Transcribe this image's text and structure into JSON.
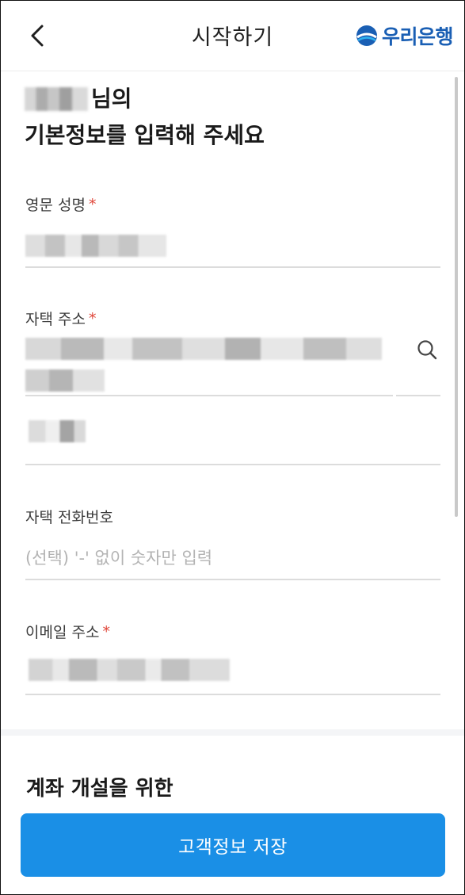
{
  "header": {
    "title": "시작하기",
    "logo_text": "우리은행"
  },
  "greeting": {
    "suffix": "님의",
    "line2": "기본정보를 입력해 주세요"
  },
  "fields": {
    "english_name": {
      "label": "영문 성명",
      "required": "*"
    },
    "home_address": {
      "label": "자택 주소",
      "required": "*"
    },
    "home_phone": {
      "label": "자택 전화번호",
      "placeholder": "(선택) '-' 없이 숫자만 입력"
    },
    "email": {
      "label": "이메일 주소",
      "required": "*"
    }
  },
  "section": {
    "title": "계좌 개설을 위한"
  },
  "footer": {
    "save_label": "고객정보 저장"
  },
  "colors": {
    "accent": "#1a8fe6",
    "required": "#e0463a",
    "brand": "#1a5fb4"
  }
}
